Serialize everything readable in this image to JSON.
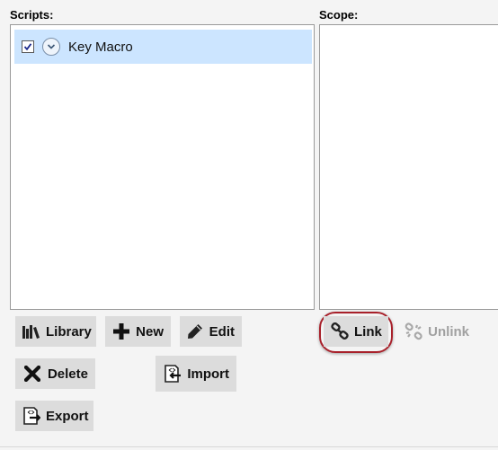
{
  "scripts": {
    "label": "Scripts:",
    "items": [
      {
        "name": "Key Macro",
        "checked": true
      }
    ]
  },
  "scope": {
    "label": "Scope:"
  },
  "buttons": {
    "library": "Library",
    "new": "New",
    "edit": "Edit",
    "delete": "Delete",
    "import": "Import",
    "export": "Export",
    "link": "Link",
    "unlink": "Unlink"
  },
  "colors": {
    "selected_row": "#cce5ff",
    "button_bg": "#dcdcdc",
    "highlight_ring": "#a8202a",
    "disabled_text": "#a0a0a0"
  }
}
